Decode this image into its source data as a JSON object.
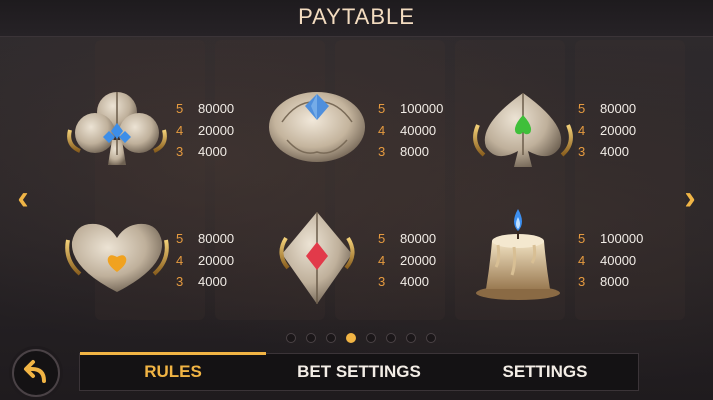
{
  "header": {
    "title": "PAYTABLE"
  },
  "paytable": [
    {
      "symbol": "club-symbol",
      "pays": [
        {
          "count": "5",
          "value": "80000"
        },
        {
          "count": "4",
          "value": "20000"
        },
        {
          "count": "3",
          "value": "4000"
        }
      ]
    },
    {
      "symbol": "rose-symbol",
      "pays": [
        {
          "count": "5",
          "value": "100000"
        },
        {
          "count": "4",
          "value": "40000"
        },
        {
          "count": "3",
          "value": "8000"
        }
      ]
    },
    {
      "symbol": "spade-symbol",
      "pays": [
        {
          "count": "5",
          "value": "80000"
        },
        {
          "count": "4",
          "value": "20000"
        },
        {
          "count": "3",
          "value": "4000"
        }
      ]
    },
    {
      "symbol": "heart-symbol",
      "pays": [
        {
          "count": "5",
          "value": "80000"
        },
        {
          "count": "4",
          "value": "20000"
        },
        {
          "count": "3",
          "value": "4000"
        }
      ]
    },
    {
      "symbol": "diamond-symbol",
      "pays": [
        {
          "count": "5",
          "value": "80000"
        },
        {
          "count": "4",
          "value": "20000"
        },
        {
          "count": "3",
          "value": "4000"
        }
      ]
    },
    {
      "symbol": "candle-symbol",
      "pays": [
        {
          "count": "5",
          "value": "100000"
        },
        {
          "count": "4",
          "value": "40000"
        },
        {
          "count": "3",
          "value": "8000"
        }
      ]
    }
  ],
  "nav": {
    "prev_icon": "chevron-left-icon",
    "next_icon": "chevron-right-icon"
  },
  "pagination": {
    "total": 8,
    "current": 4
  },
  "tabs": [
    {
      "label": "RULES",
      "active": true
    },
    {
      "label": "BET SETTINGS",
      "active": false
    },
    {
      "label": "SETTINGS",
      "active": false
    }
  ],
  "back_button": {
    "icon": "undo-arrow-icon"
  },
  "colors": {
    "accent": "#f1b444",
    "count": "#e59a3f",
    "value": "#f1ece6",
    "title": "#f3dcc0"
  }
}
